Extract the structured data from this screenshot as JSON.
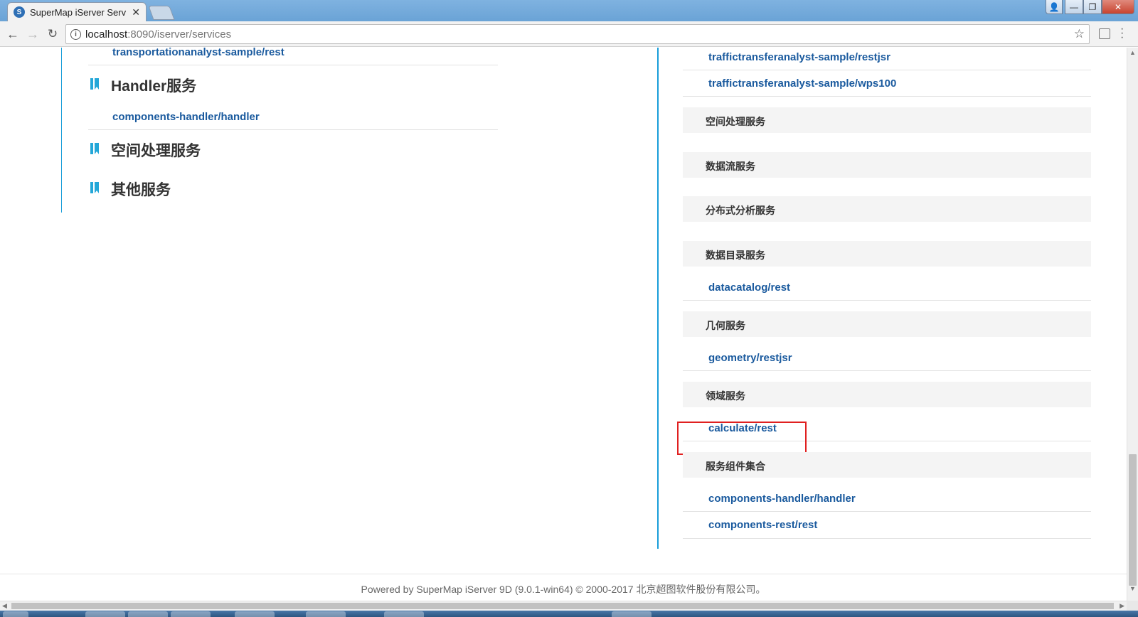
{
  "browser": {
    "tab_title": "SuperMap iServer Serv",
    "tab_favicon": "S",
    "url_host": "localhost",
    "url_path": ":8090/iserver/services"
  },
  "left_column": {
    "top_link": "transportationanalyst-sample/rest",
    "sections": [
      {
        "title": "Handler服务",
        "links": [
          "components-handler/handler"
        ]
      },
      {
        "title": "空间处理服务",
        "links": []
      },
      {
        "title": "其他服务",
        "links": []
      }
    ]
  },
  "right_column": {
    "top_links": [
      "traffictransferanalyst-sample/restjsr",
      "traffictransferanalyst-sample/wps100"
    ],
    "categories": [
      {
        "label": "空间处理服务",
        "links": []
      },
      {
        "label": "数据流服务",
        "links": []
      },
      {
        "label": "分布式分析服务",
        "links": []
      },
      {
        "label": "数据目录服务",
        "links": [
          "datacatalog/rest"
        ]
      },
      {
        "label": "几何服务",
        "links": [
          "geometry/restjsr"
        ]
      },
      {
        "label": "领域服务",
        "links": [
          "calculate/rest"
        ]
      },
      {
        "label": "服务组件集合",
        "links": [
          "components-handler/handler",
          "components-rest/rest"
        ]
      }
    ]
  },
  "footer": {
    "text": "Powered by SuperMap iServer 9D (9.0.1-win64) © 2000-2017 北京超图软件股份有限公司。"
  },
  "colors": {
    "link": "#1a5a9e",
    "accent_line": "#1a9ed9",
    "highlight": "#e02020"
  }
}
